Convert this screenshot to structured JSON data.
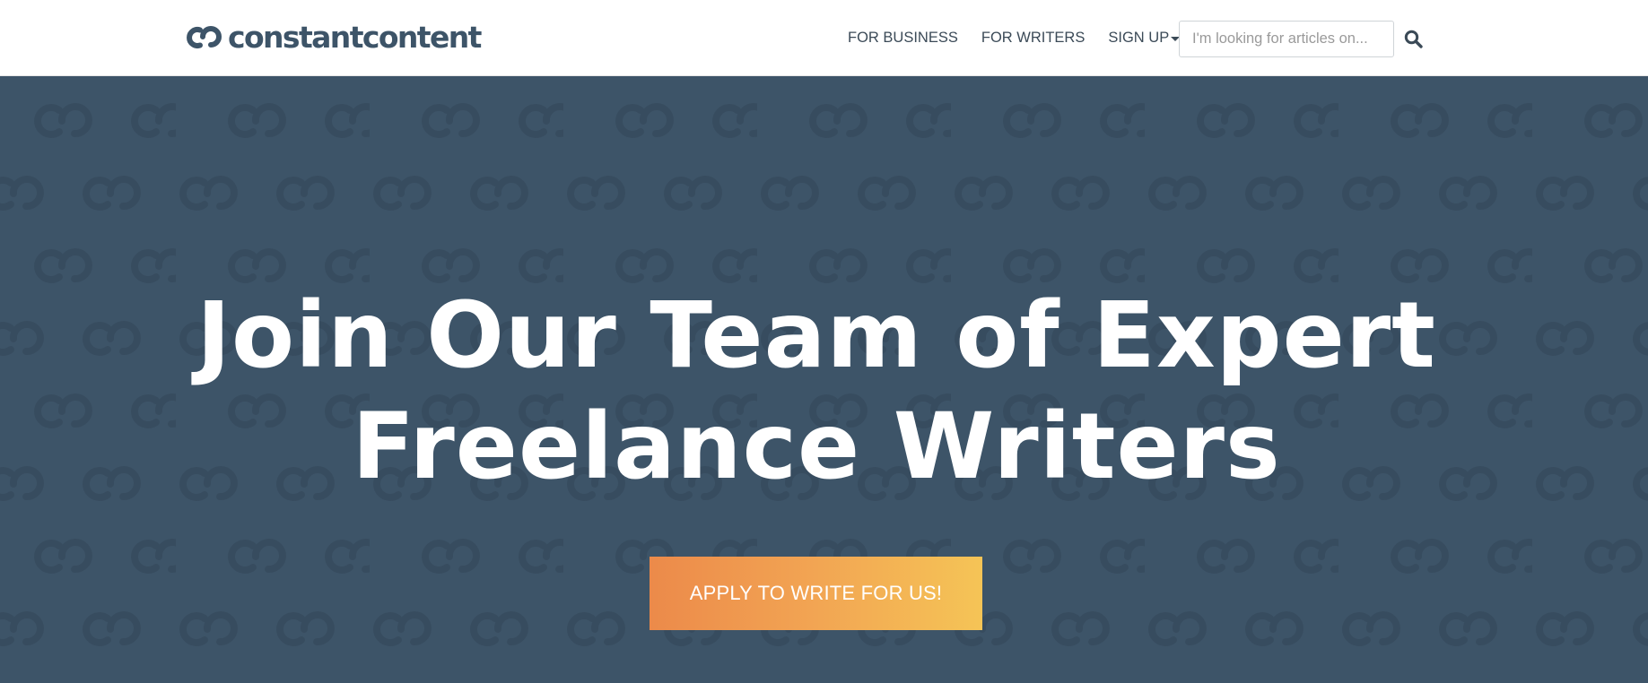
{
  "brand": {
    "name": "constantcontent",
    "logo_icon": "linked-c-logo-icon"
  },
  "nav": {
    "items": [
      {
        "label": "FOR BUSINESS"
      },
      {
        "label": "FOR WRITERS"
      },
      {
        "label": "SIGN UP"
      }
    ],
    "signup_icon": "caret-down-icon"
  },
  "search": {
    "placeholder": "I'm looking for articles on...",
    "value": "",
    "icon": "search-icon"
  },
  "hero": {
    "headline_line1": "Join Our Team of Expert",
    "headline_line2": "Freelance Writers",
    "cta_label": "APPLY TO WRITE FOR US!",
    "pattern_icon": "linked-c-pattern"
  },
  "colors": {
    "brand": "#3d5468",
    "hero_background": "#3d5468",
    "cta_gradient_start": "#ec8a4a",
    "cta_gradient_end": "#f5c456",
    "nav_text": "#3b4a57"
  }
}
